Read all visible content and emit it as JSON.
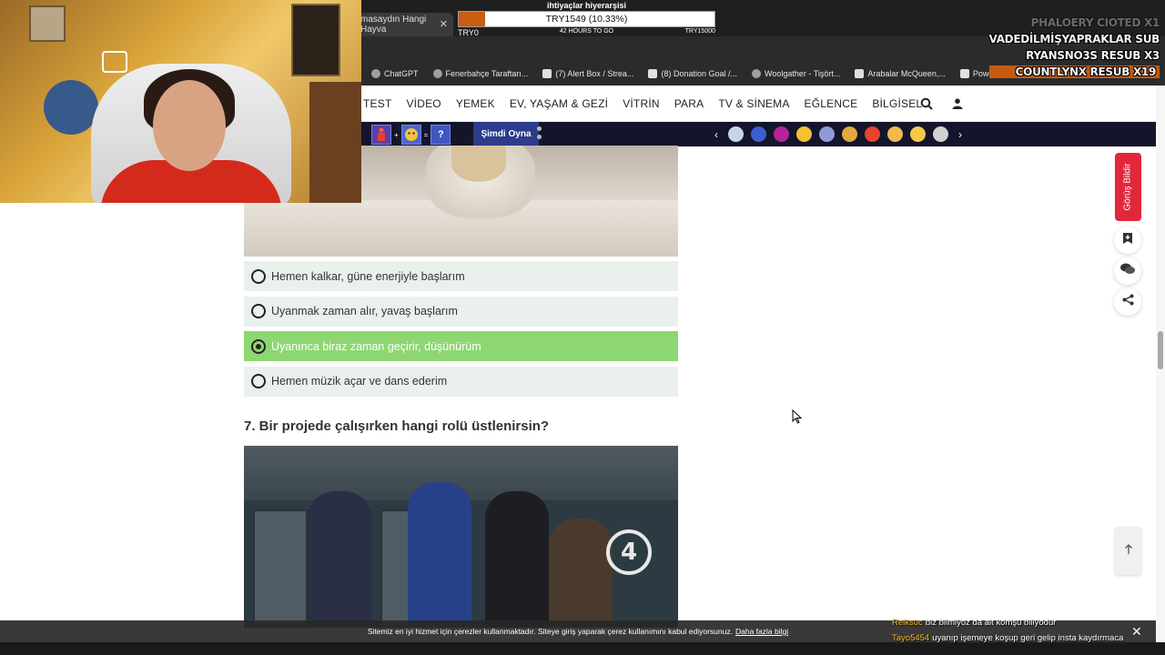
{
  "browser": {
    "tab_title": "masaydın Hangi Hayva",
    "bookmarks": [
      {
        "label": "ChatGPT"
      },
      {
        "label": "Fenerbahçe Taraftarı..."
      },
      {
        "label": "(7) Alert Box / Strea..."
      },
      {
        "label": "(8) Donation Goal /..."
      },
      {
        "label": "Woolgather - Tişört..."
      },
      {
        "label": "Arabalar McQueen,..."
      },
      {
        "label": "Powerpuff Girls Blos..."
      }
    ]
  },
  "nav": {
    "items": [
      "TEST",
      "VİDEO",
      "YEMEK",
      "EV, YAŞAM & GEZİ",
      "VİTRİN",
      "PARA",
      "TV & SİNEMA",
      "EĞLENCE",
      "BİLGİSEL"
    ]
  },
  "game_strip": {
    "puzzle_eq": "=",
    "puzzle_q": "?",
    "play_label": "Şimdi Oyna",
    "emoji_colors": [
      "#c9d4e8",
      "#3b5fd1",
      "#b4249a",
      "#f2c233",
      "#8f9ad8",
      "#e0a93a",
      "#e8432f",
      "#f2b94a",
      "#f5c84a",
      "#d0d0d0"
    ]
  },
  "quiz": {
    "options": [
      {
        "label": "Hemen kalkar, güne enerjiyle başlarım",
        "selected": false
      },
      {
        "label": "Uyanmak zaman alır, yavaş başlarım",
        "selected": false
      },
      {
        "label": "Uyanınca biraz zaman geçirir, düşünürüm",
        "selected": true
      },
      {
        "label": "Hemen müzik açar ve dans ederim",
        "selected": false
      }
    ],
    "question": "7. Bir projede çalışırken hangi rolü üstlenirsin?"
  },
  "side": {
    "feedback_label": "Görüş Bildir"
  },
  "cookie": {
    "text": "Sitemiz en iyi hizmet için çerezler kullanmaktadır. Siteye giriş yaparak çerez kullanımını kabul ediyorsunuz.",
    "link": "Daha fazla bilgi"
  },
  "stream": {
    "donation_title": "ihtiyaçlar hiyerarşisi",
    "donation_value": "TRY1549 (10.33%)",
    "donation_progress": 0.1033,
    "donation_start": "TRY0",
    "donation_time": "42 HOURS TO GO",
    "donation_goal": "TRY15000",
    "alerts": [
      {
        "text": "PHALOERY  CIOTED X1",
        "style": "faded"
      },
      {
        "text": "VADEDİLMİŞYAPRAKLAR  SUB",
        "style": ""
      },
      {
        "text": "RYANSNO3S  RESUB X3",
        "style": ""
      },
      {
        "text": "COUNTLYNX  RESUB X19",
        "style": "highlight"
      }
    ],
    "chat": [
      {
        "user": "Reiksuc",
        "message": "biz bilmiyoz da alt komşu biliyodur"
      },
      {
        "user": "Tayo5454",
        "message": "uyanıp işemeye koşup geri gelip insta kaydırmaca"
      }
    ]
  },
  "colors": {
    "selected_option": "#8ed672",
    "option_bg": "#eaf1ec",
    "feedback_red": "#e0283a",
    "donation_fill": "#c95d10"
  }
}
